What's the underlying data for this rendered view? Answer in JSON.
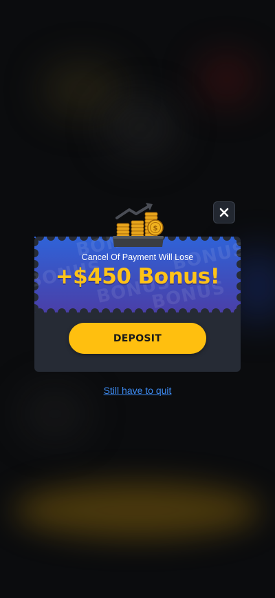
{
  "popup": {
    "subtitle": "Cancel Of Payment Will Lose",
    "amount": "+$450 Bonus!",
    "watermark_text": "BONUS",
    "deposit_label": "DEPOSIT",
    "quit_label": "Still have to quit",
    "close_icon": "close-icon",
    "illustration_icon": "coins-growth-icon"
  },
  "colors": {
    "accent": "#ffbf0f",
    "ticket_top": "#2f63d8",
    "ticket_bottom": "#4a3fa8",
    "link": "#3d8bf2",
    "panel": "#262b35"
  }
}
